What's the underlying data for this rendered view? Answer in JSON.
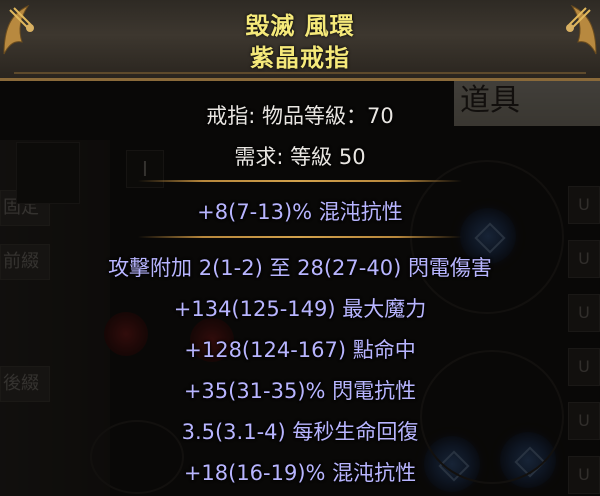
{
  "item": {
    "name": "毀滅 風環",
    "base_type": "紫晶戒指",
    "properties": [
      "戒指: 物品等級：70",
      "需求: 等級 50"
    ],
    "implicit_mods": [
      "+8(7-13)% 混沌抗性"
    ],
    "explicit_mods": [
      "攻擊附加 2(1-2) 至 28(27-40) 閃電傷害",
      "+134(125-149) 最大魔力",
      "+128(124-167) 點命中",
      "+35(31-35)% 閃電抗性",
      "3.5(3.1-4) 每秒生命回復",
      "+18(16-19)% 混沌抗性"
    ]
  },
  "background": {
    "side_tabs": [
      "固定",
      "前綴",
      "後綴"
    ],
    "inventory_tab_label": "道具",
    "right_slot_glyph": "U",
    "tab_glyph": "I"
  },
  "colors": {
    "title": "#f5e97a",
    "property_text": "#e9e6e2",
    "mod_text": "#b8b5ff",
    "separator": "#c69641"
  }
}
